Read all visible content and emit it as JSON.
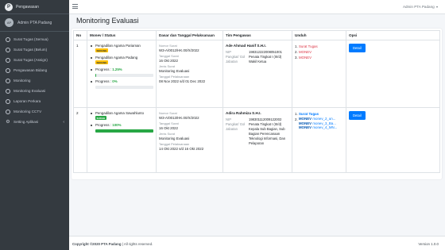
{
  "brand": {
    "logo_letter": "P",
    "title": "Pengawasan"
  },
  "user_panel": {
    "initials": "AP",
    "name": "Admin PTA Padang"
  },
  "sidebar": {
    "items": [
      {
        "label": "Surat Tugas (Semua)",
        "icon": "circle-icon"
      },
      {
        "label": "Surat Tugas (Belum)",
        "icon": "circle-icon"
      },
      {
        "label": "Surat Tugas (Assign)",
        "icon": "circle-icon"
      },
      {
        "label": "Pengawasan Bidang",
        "icon": "circle-icon"
      },
      {
        "label": "Monitoring",
        "icon": "circle-icon"
      },
      {
        "label": "Monitoring Evaluasi",
        "icon": "circle-icon"
      },
      {
        "label": "Laporan Perkara",
        "icon": "circle-icon"
      },
      {
        "label": "Monitoring CCTV",
        "icon": "circle-icon"
      },
      {
        "label": "Setting Aplikasi",
        "icon": "gear-icon",
        "chevron": "‹"
      }
    ]
  },
  "topbar": {
    "user": "Admin PTA Padang",
    "caret": "▾"
  },
  "page": {
    "title": "Monitoring Evaluasi"
  },
  "table": {
    "headers": [
      "No",
      "Monev / Status",
      "Dasar dan Tanggal Pelaksanaan",
      "Tim Pengawas",
      "Unduh",
      "Opsi"
    ],
    "rows": [
      {
        "no": "1",
        "monev": [
          {
            "name": "Pengadilan Agama Pariaman",
            "status": "SEDANG"
          },
          {
            "name": "Pengadilan Agama Padang",
            "status": "SEDANG"
          }
        ],
        "progress": [
          {
            "label": "Progress :",
            "value": "1.25%",
            "fraction": 0.0125
          },
          {
            "label": "Progress :",
            "value": "0%",
            "fraction": 0
          }
        ],
        "dasar": {
          "nomor_label": "Nomor Surat",
          "nomor": "W3-A/0012/HK.00/X/2022",
          "tanggal_label": "Tanggal Surat",
          "tanggal": "16 Okt 2022",
          "jenis_label": "Jenis Surat",
          "jenis": "Monitoring Evaluasi",
          "pelaksanaan_label": "Tanggal Pelaksanaan",
          "pelaksanaan": "08 Nov 2022 s/d 01 Dec 2022"
        },
        "tim": {
          "name": "Ade Ahmad Hanif S.H.I.",
          "nip_label": "NIP",
          "nip": "198312222008051001",
          "pangkat_label": "Pangkat/ Gol",
          "pangkat": "Penata Tingkat I (III/d)",
          "jabatan_label": "Jabatan",
          "jabatan": "Wakil Ketua"
        },
        "unduh": [
          {
            "idx": "1.",
            "label": "Surat Tugas"
          },
          {
            "idx": "2.",
            "label": "MONEV"
          },
          {
            "idx": "3.",
            "label": "MONEV"
          }
        ],
        "button": "Detail"
      },
      {
        "no": "2",
        "monev": [
          {
            "name": "Pengadilan Agama Sawahlunto",
            "status": "SUDAH"
          }
        ],
        "progress": [
          {
            "label": "Progress :",
            "value": "100%",
            "fraction": 1
          }
        ],
        "dasar": {
          "nomor_label": "Nomor Surat",
          "nomor": "W3-A/0013/HK.00/X/2022",
          "tanggal_label": "Tanggal Surat",
          "tanggal": "16 Okt 2022",
          "jenis_label": "Jenis Surat",
          "jenis": "Monitoring Evaluasi",
          "pelaksanaan_label": "Tanggal Pelaksanaan",
          "pelaksanaan": "14 Okt 2022 s/d 16 Okt 2022"
        },
        "tim": {
          "name": "Adira Rahmiza S.H.I.",
          "nip_label": "NIP",
          "nip": "198301112009122002",
          "pangkat_label": "Pangkat/ Gol",
          "pangkat": "Penata Tingkat I (III/d)",
          "jabatan_label": "Jabatan",
          "jabatan": "Kepala Sub Bagian, Sub Bagian Perencanaan Teknologi Informasi, Dan Pelaporan"
        },
        "unduh": [
          {
            "idx": "1.",
            "label": "Surat Tugas"
          },
          {
            "idx": "2.",
            "label": "MONEV",
            "files": [
              "monev_2_un...",
              "monev_3_Ba...",
              "monev_4_MN..."
            ]
          }
        ],
        "button": "Detail"
      }
    ]
  },
  "footer": {
    "copyright": "Copyright ©2020 PTA Padang",
    "rights": " | All rights reserved.",
    "version": "Version 1.0.0"
  }
}
